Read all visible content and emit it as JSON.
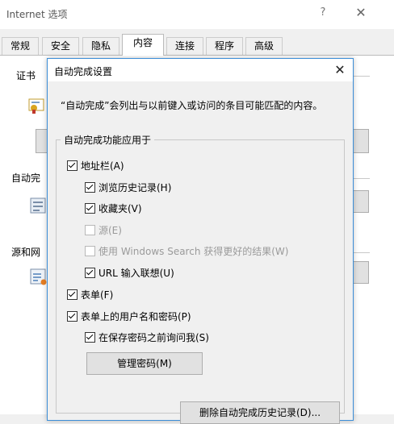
{
  "window": {
    "title": "Internet 选项",
    "help": "?",
    "close": "✕"
  },
  "tabs": [
    {
      "label": "常规"
    },
    {
      "label": "安全"
    },
    {
      "label": "隐私"
    },
    {
      "label": "内容",
      "active": true
    },
    {
      "label": "连接"
    },
    {
      "label": "程序"
    },
    {
      "label": "高级"
    }
  ],
  "panel": {
    "cert_label": "证书",
    "autocomplete_label": "自动完",
    "feeds_label": "源和网"
  },
  "dialog": {
    "title": "自动完成设置",
    "close": "✕",
    "description": "“自动完成”会列出与以前键入或访问的条目可能匹配的内容。",
    "group_title": "自动完成功能应用于",
    "options": {
      "address_bar": {
        "label": "地址栏(A)",
        "checked": true
      },
      "history": {
        "label": "浏览历史记录(H)",
        "checked": true
      },
      "favorites": {
        "label": "收藏夹(V)",
        "checked": true
      },
      "feeds": {
        "label": "源(E)",
        "checked": false,
        "disabled": true
      },
      "windows_search": {
        "label": "使用 Windows Search 获得更好的结果(W)",
        "checked": false,
        "disabled": true
      },
      "url_suggest": {
        "label": "URL 输入联想(U)",
        "checked": true
      },
      "forms": {
        "label": "表单(F)",
        "checked": true
      },
      "form_credentials": {
        "label": "表单上的用户名和密码(P)",
        "checked": true
      },
      "ask_before_save": {
        "label": "在保存密码之前询问我(S)",
        "checked": true
      }
    },
    "manage_passwords_button": "管理密码(M)",
    "delete_history_button": "删除自动完成历史记录(D)..."
  },
  "colors": {
    "accent": "#3c8ed8",
    "disabled_text": "#9a9a9a"
  }
}
